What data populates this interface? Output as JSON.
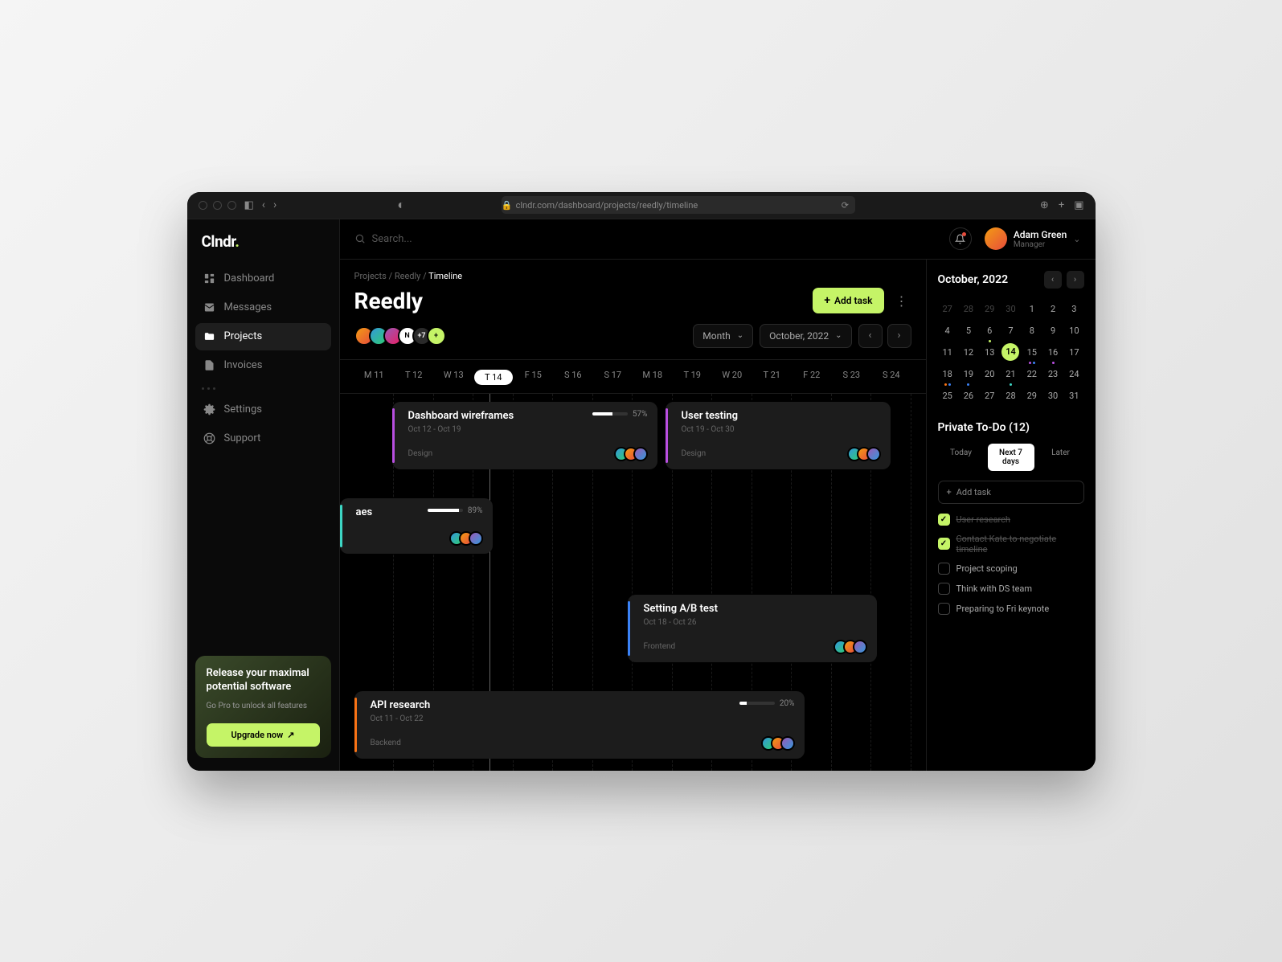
{
  "browser": {
    "url": "clndr.com/dashboard/projects/reedly/timeline"
  },
  "app_name": "Clndr",
  "sidebar": {
    "items": [
      {
        "label": "Dashboard",
        "icon": "dashboard"
      },
      {
        "label": "Messages",
        "icon": "messages"
      },
      {
        "label": "Projects",
        "icon": "folder",
        "active": true
      },
      {
        "label": "Invoices",
        "icon": "file"
      }
    ],
    "items2": [
      {
        "label": "Settings",
        "icon": "gear"
      },
      {
        "label": "Support",
        "icon": "lifebuoy"
      }
    ]
  },
  "upgrade": {
    "title": "Release your maximal potential software",
    "subtitle": "Go Pro to unlock all features",
    "button": "Upgrade now"
  },
  "search": {
    "placeholder": "Search..."
  },
  "user": {
    "name": "Adam Green",
    "role": "Manager"
  },
  "breadcrumb": {
    "p1": "Projects",
    "p2": "Reedly",
    "p3": "Timeline"
  },
  "project": {
    "title": "Reedly",
    "add_task": "Add task",
    "members_extra": "+7"
  },
  "controls": {
    "view": "Month",
    "period": "October, 2022"
  },
  "days": [
    "M 11",
    "T 12",
    "W 13",
    "T 14",
    "F 15",
    "S 16",
    "S 17",
    "M 18",
    "T 19",
    "W 20",
    "T 21",
    "F 22",
    "S 23",
    "S 24"
  ],
  "active_day_index": 3,
  "tasks": [
    {
      "title": "Dashboard wireframes",
      "dates": "Oct 12 - Oct 19",
      "tag": "Design",
      "progress": 57,
      "color": "#b84fe0"
    },
    {
      "title": "User testing",
      "dates": "Oct 19 - Oct 30",
      "tag": "Design",
      "color": "#b84fe0"
    },
    {
      "title": "aes",
      "dates": "",
      "tag": "",
      "progress": 89,
      "color": "#3dd6c4"
    },
    {
      "title": "Setting A/B test",
      "dates": "Oct 18 - Oct 26",
      "tag": "Frontend",
      "color": "#3b82f6"
    },
    {
      "title": "API research",
      "dates": "Oct 11 - Oct 22",
      "tag": "Backend",
      "progress": 20,
      "color": "#f97316"
    }
  ],
  "calendar": {
    "title": "October, 2022",
    "weeks": [
      [
        {
          "d": 27,
          "m": true
        },
        {
          "d": 28,
          "m": true
        },
        {
          "d": 29,
          "m": true
        },
        {
          "d": 30,
          "m": true
        },
        {
          "d": 1
        },
        {
          "d": 2
        },
        {
          "d": 3
        }
      ],
      [
        {
          "d": 4
        },
        {
          "d": 5
        },
        {
          "d": 6,
          "dots": [
            "#c5f467"
          ]
        },
        {
          "d": 7
        },
        {
          "d": 8
        },
        {
          "d": 9
        },
        {
          "d": 10
        }
      ],
      [
        {
          "d": 11
        },
        {
          "d": 12
        },
        {
          "d": 13
        },
        {
          "d": 14,
          "today": true
        },
        {
          "d": 15,
          "dots": [
            "#b84fe0",
            "#3b82f6"
          ]
        },
        {
          "d": 16,
          "dots": [
            "#b84fe0"
          ]
        },
        {
          "d": 17
        }
      ],
      [
        {
          "d": 18,
          "dots": [
            "#f97316",
            "#3b82f6"
          ]
        },
        {
          "d": 19,
          "dots": [
            "#3b82f6"
          ]
        },
        {
          "d": 20
        },
        {
          "d": 21,
          "dots": [
            "#3dd6c4"
          ]
        },
        {
          "d": 22
        },
        {
          "d": 23
        },
        {
          "d": 24
        }
      ],
      [
        {
          "d": 25
        },
        {
          "d": 26
        },
        {
          "d": 27
        },
        {
          "d": 28
        },
        {
          "d": 29
        },
        {
          "d": 30
        },
        {
          "d": 31
        }
      ]
    ]
  },
  "todo": {
    "title": "Private To-Do (12)",
    "tabs": [
      "Today",
      "Next 7 days",
      "Later"
    ],
    "active_tab": 1,
    "add": "Add task",
    "items": [
      {
        "text": "User research",
        "done": true
      },
      {
        "text": "Contact Kate to negotiate timeline",
        "done": true
      },
      {
        "text": "Project scoping",
        "done": false
      },
      {
        "text": "Think with DS team",
        "done": false
      },
      {
        "text": "Preparing to Fri keynote",
        "done": false
      }
    ]
  },
  "colors": {
    "accent": "#c5f467"
  }
}
